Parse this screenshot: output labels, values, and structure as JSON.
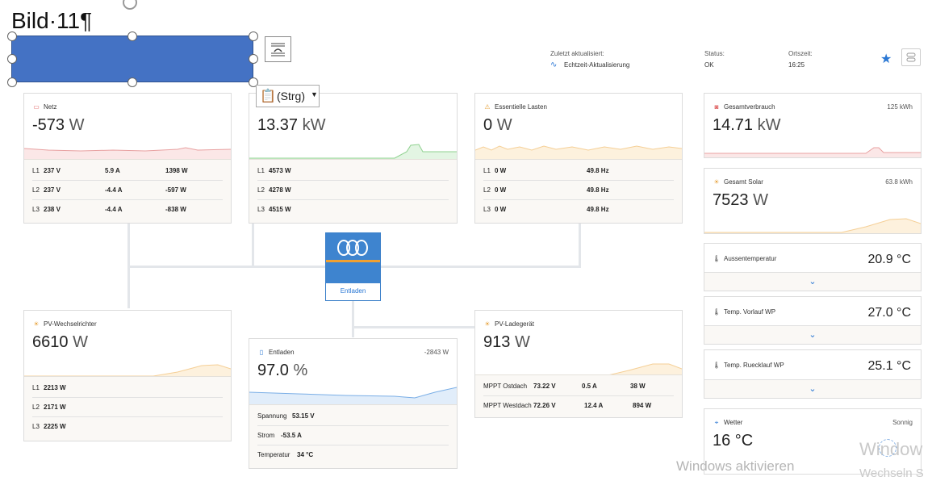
{
  "doc": {
    "heading": "Bild·11¶",
    "paste_label": "(Strg)",
    "watermark_line1": "Windows aktivieren",
    "watermark_cut1": "Window",
    "watermark_cut2": "Wechseln S",
    "shape_color": "#4472c4"
  },
  "header": {
    "updated_label": "Zuletzt aktualisiert:",
    "updated_value": "Echtzeit-Aktualisierung",
    "status_label": "Status:",
    "status_value": "OK",
    "time_label": "Ortszeit:",
    "time_value": "16:25"
  },
  "grid": {
    "title": "Netz",
    "value": "-573",
    "unit": "W",
    "rows": [
      {
        "phase": "L1",
        "v": "237 V",
        "a": "5.9 A",
        "w": "1398 W"
      },
      {
        "phase": "L2",
        "v": "237 V",
        "a": "-4.4 A",
        "w": "-597 W"
      },
      {
        "phase": "L3",
        "v": "238 V",
        "a": "-4.4 A",
        "w": "-838 W"
      }
    ]
  },
  "ac_in": {
    "value": "13.37",
    "unit": "kW",
    "rows": [
      {
        "phase": "L1",
        "w": "4573 W"
      },
      {
        "phase": "L2",
        "w": "4278 W"
      },
      {
        "phase": "L3",
        "w": "4515 W"
      }
    ]
  },
  "essential": {
    "title": "Essentielle Lasten",
    "value": "0",
    "unit": "W",
    "rows": [
      {
        "phase": "L1",
        "w": "0 W",
        "hz": "49.8 Hz"
      },
      {
        "phase": "L2",
        "w": "0 W",
        "hz": "49.8 Hz"
      },
      {
        "phase": "L3",
        "w": "0 W",
        "hz": "49.8 Hz"
      }
    ]
  },
  "total_consumption": {
    "title": "Gesamtverbrauch",
    "energy": "125 kWh",
    "value": "14.71",
    "unit": "kW"
  },
  "total_solar": {
    "title": "Gesamt Solar",
    "energy": "63.8 kWh",
    "value": "7523",
    "unit": "W"
  },
  "temps": [
    {
      "title": "Aussentemperatur",
      "value": "20.9 °C"
    },
    {
      "title": "Temp. Vorlauf WP",
      "value": "27.0 °C"
    },
    {
      "title": "Temp. Ruecklauf WP",
      "value": "25.1 °C"
    }
  ],
  "weather": {
    "title": "Wetter",
    "condition": "Sonnig",
    "value": "16 °C"
  },
  "inverter": {
    "state": "Entladen"
  },
  "pv_inverter": {
    "title": "PV-Wechselrichter",
    "value": "6610",
    "unit": "W",
    "rows": [
      {
        "phase": "L1",
        "w": "2213 W"
      },
      {
        "phase": "L2",
        "w": "2171 W"
      },
      {
        "phase": "L3",
        "w": "2225 W"
      }
    ]
  },
  "battery": {
    "title": "Entladen",
    "power": "-2843 W",
    "value": "97.0",
    "unit": "%",
    "voltage_label": "Spannung",
    "voltage": "53.15 V",
    "current_label": "Strom",
    "current": "-53.5 A",
    "temp_label": "Temperatur",
    "temp": "34 °C"
  },
  "pv_charger": {
    "title": "PV-Ladegerät",
    "value": "913",
    "unit": "W",
    "rows": [
      {
        "name": "MPPT Ostdach",
        "v": "73.22 V",
        "a": "0.5 A",
        "w": "38 W"
      },
      {
        "name": "MPPT Westdach",
        "v": "72.26 V",
        "a": "12.4 A",
        "w": "894 W"
      }
    ]
  },
  "colors": {
    "accent": "#2b78d4",
    "grid_spark": "#e8a0a0",
    "green_spark": "#8fd18f",
    "orange_spark": "#f5cf96",
    "battery_spark": "#7aaee6"
  }
}
